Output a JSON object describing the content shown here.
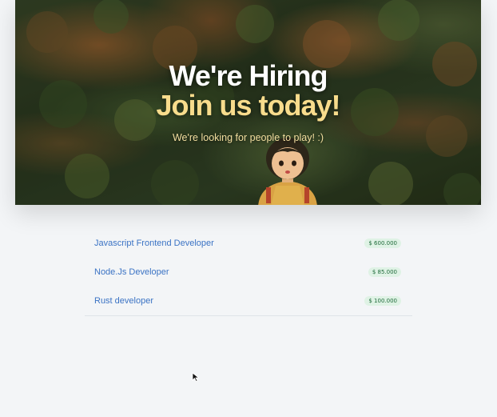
{
  "hero": {
    "title": "We're Hiring",
    "subtitle": "Join us today!",
    "tagline": "We're looking for people to play! :)"
  },
  "jobs": [
    {
      "title": "Javascript Frontend Developer",
      "salary": "$ 600.000"
    },
    {
      "title": "Node.Js Developer",
      "salary": "$ 85.000"
    },
    {
      "title": "Rust developer",
      "salary": "$ 100.000"
    }
  ],
  "colors": {
    "link": "#3b73c4",
    "accent_heading": "#f8dc8c",
    "badge_bg": "#dff2e5",
    "badge_text": "#1f6b3a"
  },
  "icons": {
    "cursor": "mouse-pointer-icon"
  }
}
